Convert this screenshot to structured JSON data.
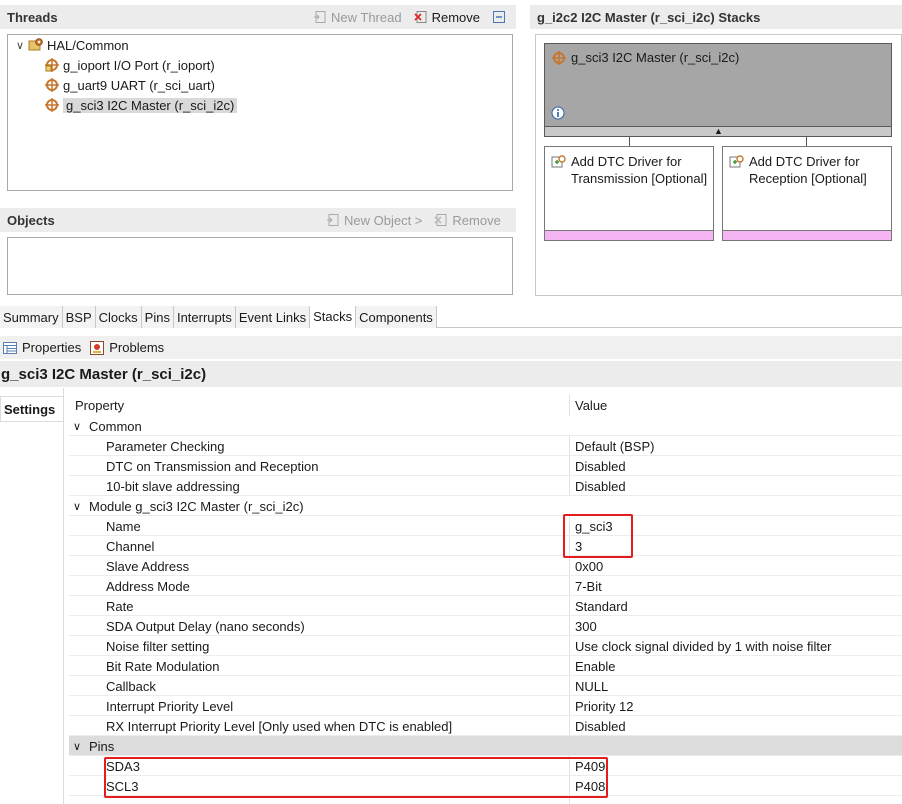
{
  "threads": {
    "title": "Threads",
    "new_thread": "New Thread",
    "remove": "Remove",
    "tree": [
      {
        "label": "HAL/Common",
        "expanded": true,
        "level": 0
      },
      {
        "label": "g_ioport I/O Port (r_ioport)",
        "level": 1
      },
      {
        "label": "g_uart9 UART (r_sci_uart)",
        "level": 1
      },
      {
        "label": "g_sci3 I2C Master (r_sci_i2c)",
        "level": 1,
        "selected": true
      }
    ]
  },
  "objects": {
    "title": "Objects",
    "new_object": "New Object >",
    "remove": "Remove"
  },
  "stacks": {
    "title": "g_i2c2 I2C Master (r_sci_i2c) Stacks",
    "main_block": "g_sci3 I2C Master (r_sci_i2c)",
    "info_icon": "info-icon",
    "sub_blocks": [
      "Add DTC Driver for Transmission [Optional]",
      "Add DTC Driver for Reception [Optional]"
    ],
    "block_color": "#a6a6a6",
    "optional_bar_color": "#f4b5f2"
  },
  "tabs": [
    "Summary",
    "BSP",
    "Clocks",
    "Pins",
    "Interrupts",
    "Event Links",
    "Stacks",
    "Components"
  ],
  "active_tab": "Stacks",
  "views": {
    "properties": "Properties",
    "problems": "Problems"
  },
  "properties": {
    "title": "g_sci3 I2C Master (r_sci_i2c)",
    "side_tab": "Settings",
    "col_property": "Property",
    "col_value": "Value",
    "rows": [
      {
        "name": "Common",
        "value": "",
        "category": true
      },
      {
        "name": "Parameter Checking",
        "value": "Default (BSP)"
      },
      {
        "name": "DTC on Transmission and Reception",
        "value": "Disabled"
      },
      {
        "name": "10-bit slave addressing",
        "value": "Disabled"
      },
      {
        "name": "Module g_sci3 I2C Master (r_sci_i2c)",
        "value": "",
        "category": true
      },
      {
        "name": "Name",
        "value": "g_sci3"
      },
      {
        "name": "Channel",
        "value": "3"
      },
      {
        "name": "Slave Address",
        "value": "0x00"
      },
      {
        "name": "Address Mode",
        "value": "7-Bit"
      },
      {
        "name": "Rate",
        "value": "Standard"
      },
      {
        "name": "SDA Output Delay (nano seconds)",
        "value": "300"
      },
      {
        "name": "Noise filter setting",
        "value": "Use clock signal divided by 1 with noise filter"
      },
      {
        "name": "Bit Rate Modulation",
        "value": "Enable"
      },
      {
        "name": "Callback",
        "value": "NULL"
      },
      {
        "name": "Interrupt Priority Level",
        "value": "Priority 12"
      },
      {
        "name": "RX Interrupt Priority Level [Only used when DTC is enabled]",
        "value": "Disabled"
      },
      {
        "name": "Pins",
        "value": "",
        "category": true
      },
      {
        "name": "SDA3",
        "value": "P409"
      },
      {
        "name": "SCL3",
        "value": "P408"
      }
    ]
  },
  "highlight_color": "#e31c1c"
}
